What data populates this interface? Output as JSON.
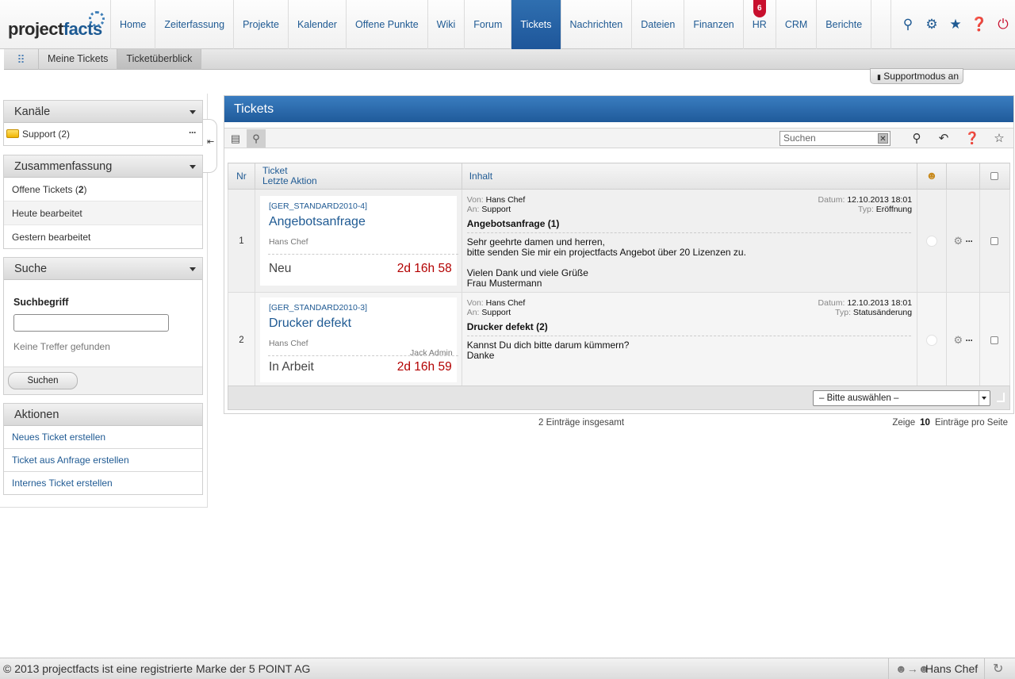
{
  "logo": {
    "part1": "project",
    "part2": "facts"
  },
  "nav": {
    "items": [
      {
        "label": "Home"
      },
      {
        "label": "Zeiterfassung"
      },
      {
        "label": "Projekte"
      },
      {
        "label": "Kalender"
      },
      {
        "label": "Offene Punkte"
      },
      {
        "label": "Wiki"
      },
      {
        "label": "Forum"
      },
      {
        "label": "Tickets",
        "active": true
      },
      {
        "label": "Nachrichten"
      },
      {
        "label": "Dateien"
      },
      {
        "label": "Finanzen"
      },
      {
        "label": "HR",
        "badge": "6"
      },
      {
        "label": "CRM"
      },
      {
        "label": "Berichte"
      }
    ],
    "icons": [
      "search-icon",
      "gear-icon",
      "star-icon",
      "help-icon",
      "power-icon"
    ]
  },
  "subnav": {
    "items": [
      {
        "label": "Meine Tickets"
      },
      {
        "label": "Ticketüberblick",
        "active": true
      }
    ]
  },
  "support_mode": "Supportmodus an",
  "sidebar": {
    "channels": {
      "title": "Kanäle",
      "items": [
        {
          "label": "Support (2)"
        }
      ]
    },
    "summary": {
      "title": "Zusammenfassung",
      "open_label": "Offene Tickets (",
      "open_count": "2",
      "open_close": ")",
      "today": "Heute bearbeitet",
      "yesterday": "Gestern bearbeitet"
    },
    "search": {
      "title": "Suche",
      "label": "Suchbegriff",
      "value": "",
      "no_results": "Keine Treffer gefunden",
      "button": "Suchen"
    },
    "actions": {
      "title": "Aktionen",
      "items": [
        "Neues Ticket erstellen",
        "Ticket aus Anfrage erstellen",
        "Internes Ticket erstellen"
      ]
    }
  },
  "main": {
    "title": "Tickets",
    "search_placeholder": "Suchen",
    "columns": {
      "nr": "Nr",
      "ticket": "Ticket",
      "last_action": "Letzte Aktion",
      "content": "Inhalt"
    },
    "rows": [
      {
        "nr": "1",
        "id": "[GER_STANDARD2010-4]",
        "title": "Angebotsanfrage",
        "creator": "Hans Chef",
        "assignee": "",
        "status": "Neu",
        "age": "2d 16h 58",
        "from_k": "Von:",
        "from": "Hans Chef",
        "to_k": "An:",
        "to": "Support",
        "date_k": "Datum:",
        "date": "12.10.2013 18:01",
        "type_k": "Typ:",
        "type": "Eröffnung",
        "subject": "Angebotsanfrage (1)",
        "body": "Sehr geehrte damen und herren,\nbitte senden Sie mir ein projectfacts Angebot über 20 Lizenzen zu.\n\nVielen Dank und viele Grüße\n Frau Mustermann"
      },
      {
        "nr": "2",
        "id": "[GER_STANDARD2010-3]",
        "title": "Drucker defekt",
        "creator": "Hans Chef",
        "assignee": "Jack Admin",
        "status": "In Arbeit",
        "age": "2d 16h 59",
        "from_k": "Von:",
        "from": "Hans Chef",
        "to_k": "An:",
        "to": "Support",
        "date_k": "Datum:",
        "date": "12.10.2013 18:01",
        "type_k": "Typ:",
        "type": "Statusänderung",
        "subject": "Drucker defekt (2)",
        "body": "Kannst Du dich bitte darum kümmern?\nDanke"
      }
    ],
    "select_value": "– Bitte auswählen –",
    "total": "2 Einträge insgesamt",
    "perpage_pre": "Zeige",
    "perpage_count": "10",
    "perpage_post": "Einträge pro Seite"
  },
  "footer": {
    "copyright": "© 2013 projectfacts ist eine registrierte Marke der 5 POINT AG",
    "user": "Hans Chef"
  }
}
